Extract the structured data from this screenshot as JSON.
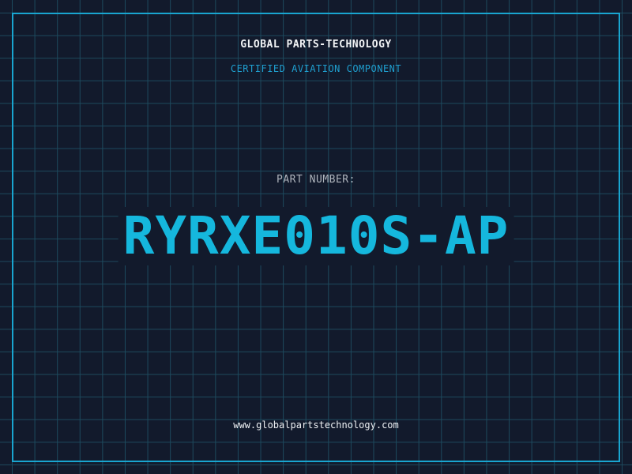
{
  "header": {
    "company": "GLOBAL PARTS-TECHNOLOGY",
    "subtitle": "CERTIFIED AVIATION COMPONENT"
  },
  "part": {
    "label": "PART NUMBER:",
    "number": "RYRXE010S-AP"
  },
  "footer": {
    "website": "www.globalpartstechnology.com"
  },
  "colors": {
    "background": "#121a2c",
    "grid": "#1d4a5e",
    "accent": "#19a5d0",
    "part_number": "#15b7dd"
  }
}
